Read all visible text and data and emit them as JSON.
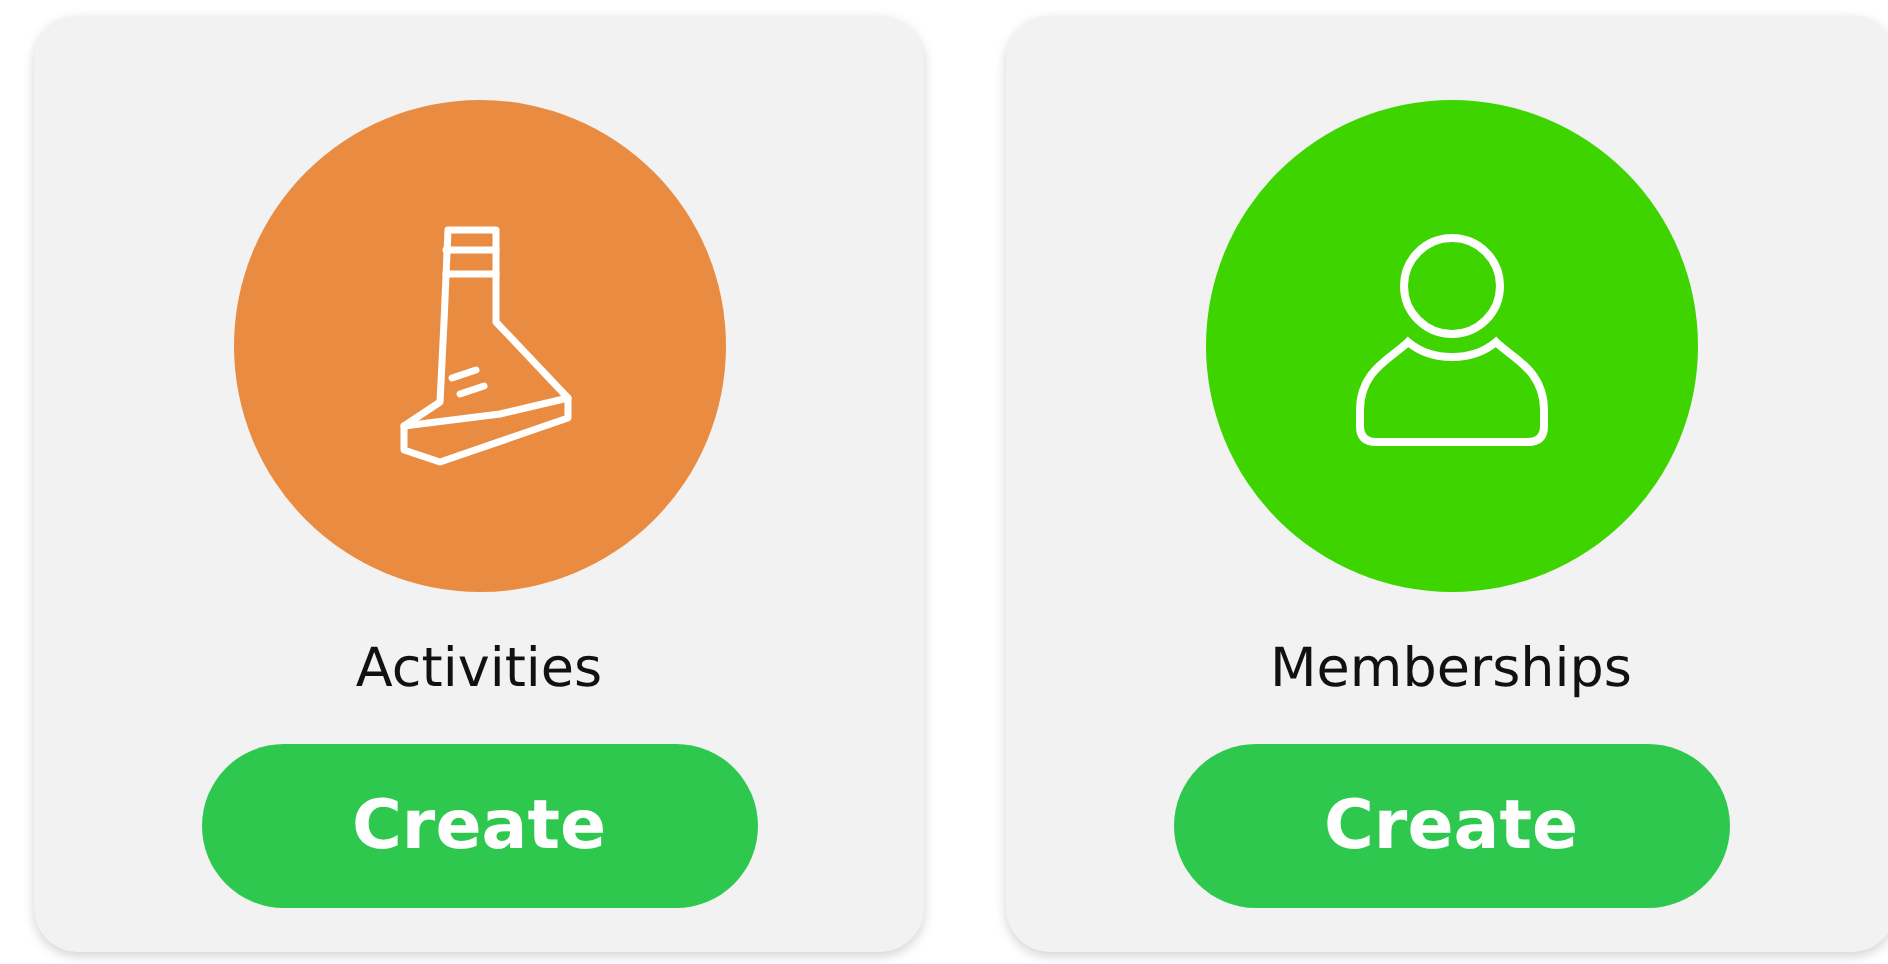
{
  "cards": [
    {
      "title": "Activities",
      "button": "Create",
      "color": "#e98c42",
      "kind": "shoe"
    },
    {
      "title": "Memberships",
      "button": "Create",
      "color": "#3ed400",
      "kind": "person"
    }
  ]
}
